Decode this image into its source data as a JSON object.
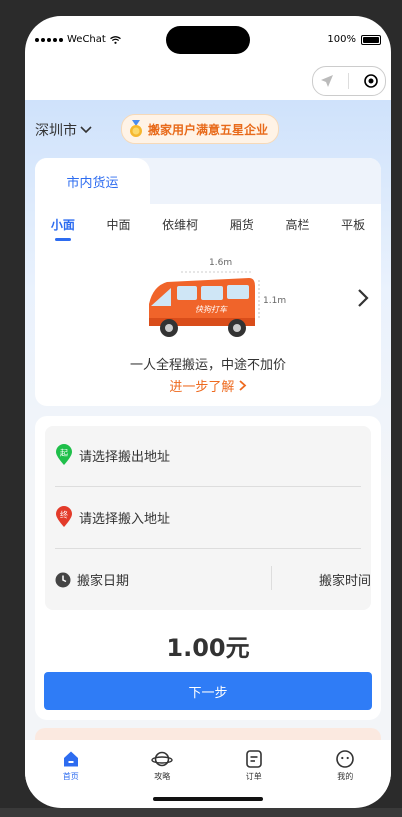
{
  "status": {
    "carrier": "WeChat",
    "battery": "100%"
  },
  "header": {
    "city": "深圳市",
    "badge": "搬家用户满意五星企业"
  },
  "service": {
    "tab": "市内货运"
  },
  "vehicle_types": [
    "小面",
    "中面",
    "依维柯",
    "厢货",
    "高栏",
    "平板"
  ],
  "vehicle": {
    "length": "1.6m",
    "height": "1.1m",
    "logo": "快狗打车",
    "desc": "一人全程搬运，中途不加价",
    "more": "进一步了解"
  },
  "form": {
    "pickup": "请选择搬出地址",
    "dropoff": "请选择搬入地址",
    "date": "搬家日期",
    "time": "搬家时间",
    "pickup_tag": "起",
    "dropoff_tag": "终"
  },
  "price": "1.00元",
  "next_label": "下一步",
  "bottom_nav": [
    {
      "label": "首页",
      "icon": "home-icon",
      "active": true
    },
    {
      "label": "攻略",
      "icon": "planet-icon",
      "active": false
    },
    {
      "label": "订单",
      "icon": "order-icon",
      "active": false
    },
    {
      "label": "我的",
      "icon": "profile-icon",
      "active": false
    }
  ],
  "colors": {
    "accent": "#2f7cf6",
    "orange": "#ee6a1f"
  }
}
